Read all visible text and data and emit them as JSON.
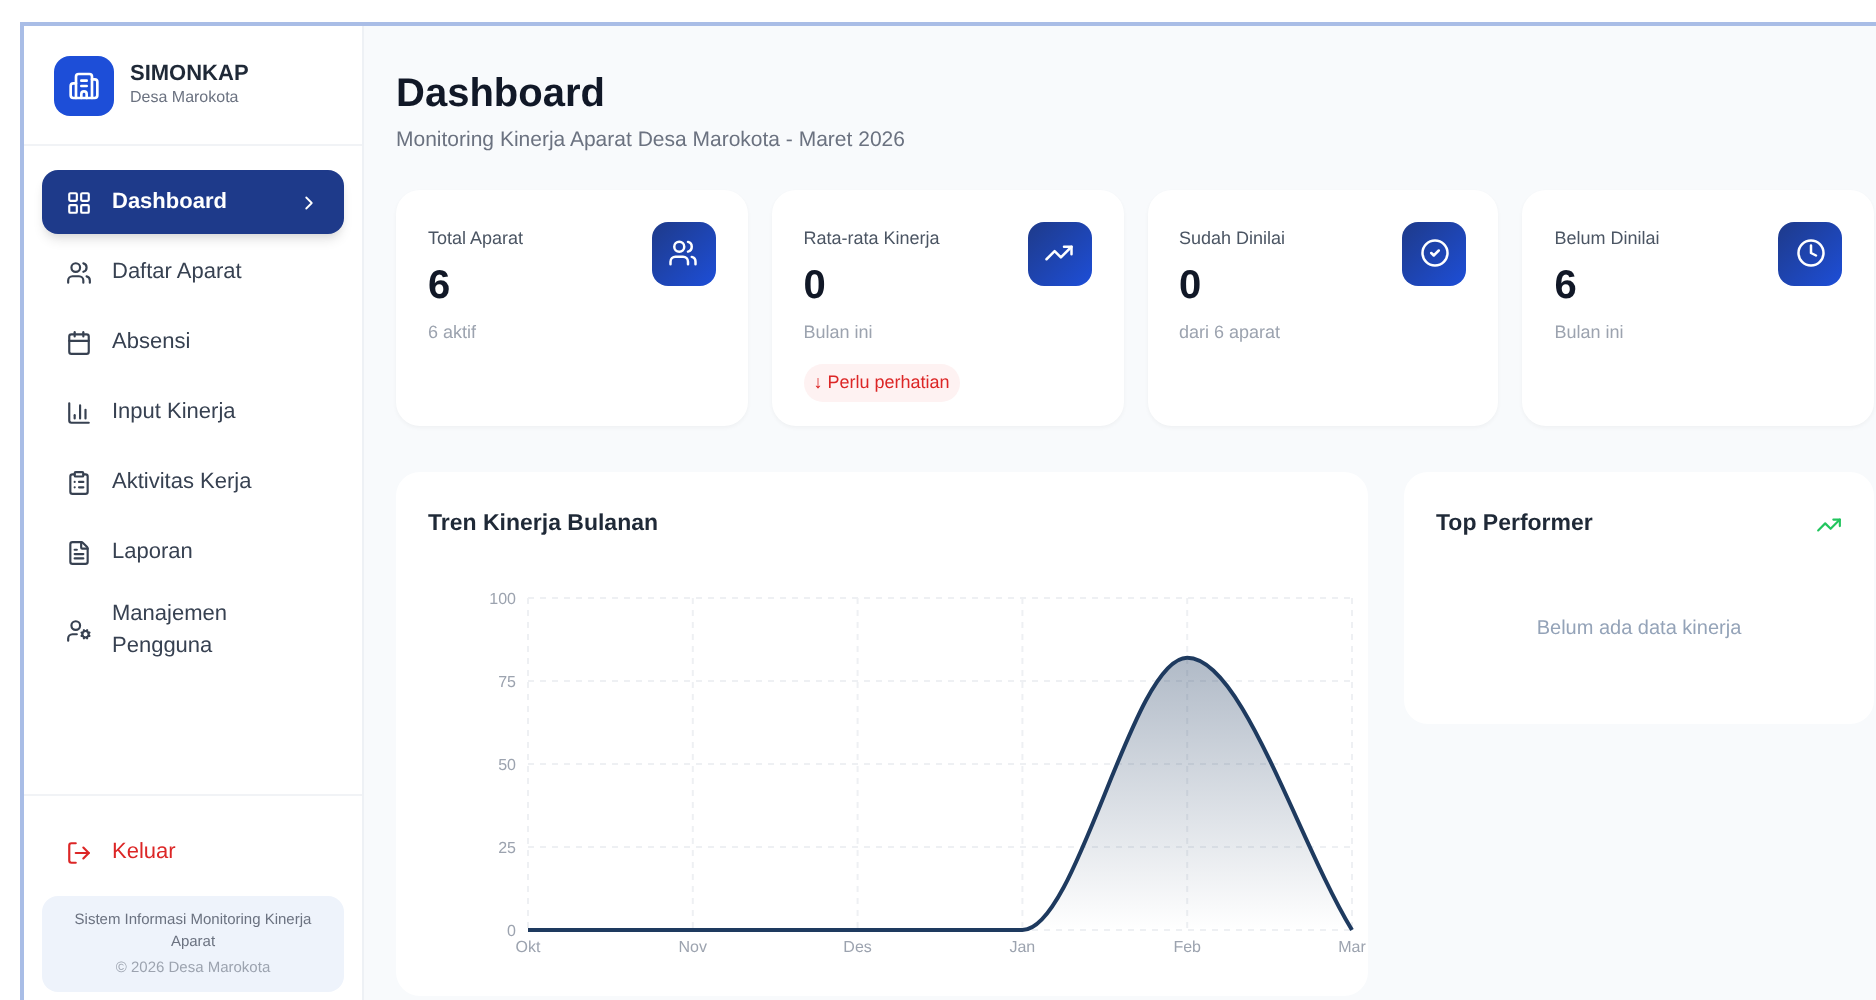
{
  "brand": {
    "name": "SIMONKAP",
    "subtitle": "Desa Marokota"
  },
  "nav": [
    {
      "label": "Dashboard",
      "selected": true
    },
    {
      "label": "Daftar Aparat",
      "selected": false
    },
    {
      "label": "Absensi",
      "selected": false
    },
    {
      "label": "Input Kinerja",
      "selected": false
    },
    {
      "label": "Aktivitas Kerja",
      "selected": false
    },
    {
      "label": "Laporan",
      "selected": false
    },
    {
      "label": "Manajemen Pengguna",
      "selected": false
    }
  ],
  "logout": "Keluar",
  "footer": {
    "line1": "Sistem Informasi Monitoring Kinerja Aparat",
    "line2": "© 2026 Desa Marokota"
  },
  "header": {
    "title": "Dashboard",
    "subtitle": "Monitoring Kinerja Aparat Desa Marokota - Maret 2026"
  },
  "stats": [
    {
      "label": "Total Aparat",
      "value": "6",
      "note": "6 aktif"
    },
    {
      "label": "Rata-rata Kinerja",
      "value": "0",
      "note": "Bulan ini",
      "badge": "↓ Perlu perhatian"
    },
    {
      "label": "Sudah Dinilai",
      "value": "0",
      "note": "dari 6 aparat"
    },
    {
      "label": "Belum Dinilai",
      "value": "6",
      "note": "Bulan ini"
    }
  ],
  "trend": {
    "title": "Tren Kinerja Bulanan",
    "chart_data": {
      "type": "area",
      "categories": [
        "Okt",
        "Nov",
        "Des",
        "Jan",
        "Feb",
        "Mar"
      ],
      "series": [
        {
          "color": "#1e3a5f",
          "values": [
            0,
            0,
            0,
            0,
            82,
            0
          ]
        }
      ],
      "ylim": [
        0,
        100
      ],
      "yticks": [
        0,
        25,
        50,
        75,
        100
      ],
      "grid": true
    }
  },
  "top_performer": {
    "title": "Top Performer",
    "empty": "Belum ada data kinerja"
  }
}
